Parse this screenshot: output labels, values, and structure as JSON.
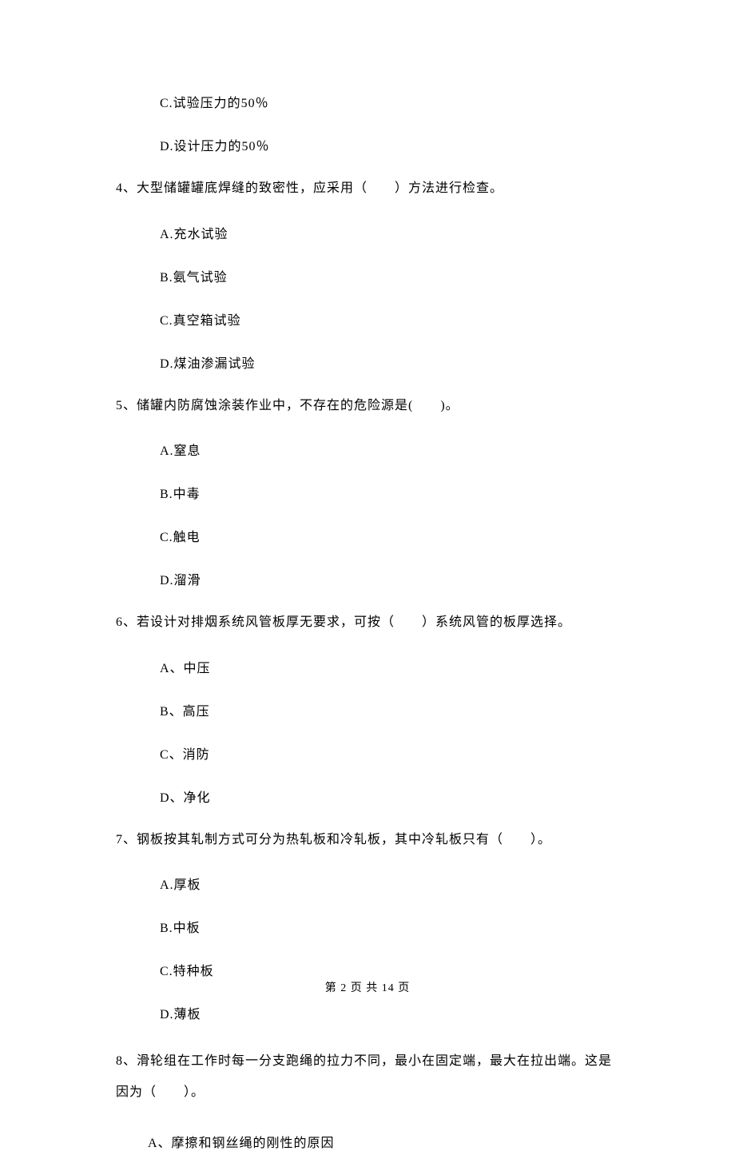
{
  "q3_options": {
    "c": "C.试验压力的50％",
    "d": "D.设计压力的50％"
  },
  "q4": {
    "text": "4、大型储罐罐底焊缝的致密性，应采用（　　）方法进行检查。",
    "options": {
      "a": "A.充水试验",
      "b": "B.氨气试验",
      "c": "C.真空箱试验",
      "d": "D.煤油渗漏试验"
    }
  },
  "q5": {
    "text": "5、储罐内防腐蚀涂装作业中，不存在的危险源是(　　)。",
    "options": {
      "a": "A.窒息",
      "b": "B.中毒",
      "c": "C.触电",
      "d": "D.溜滑"
    }
  },
  "q6": {
    "text": "6、若设计对排烟系统风管板厚无要求，可按（　　）系统风管的板厚选择。",
    "options": {
      "a": "A、中压",
      "b": "B、高压",
      "c": "C、消防",
      "d": "D、净化"
    }
  },
  "q7": {
    "text": "7、钢板按其轧制方式可分为热轧板和冷轧板，其中冷轧板只有（　　）。",
    "options": {
      "a": "A.厚板",
      "b": "B.中板",
      "c": "C.特种板",
      "d": "D.薄板"
    }
  },
  "q8": {
    "text": "8、滑轮组在工作时每一分支跑绳的拉力不同，最小在固定端，最大在拉出端。这是因为（　　）。",
    "options": {
      "a": "A、摩擦和钢丝绳的刚性的原因"
    }
  },
  "footer": "第 2 页 共 14 页"
}
